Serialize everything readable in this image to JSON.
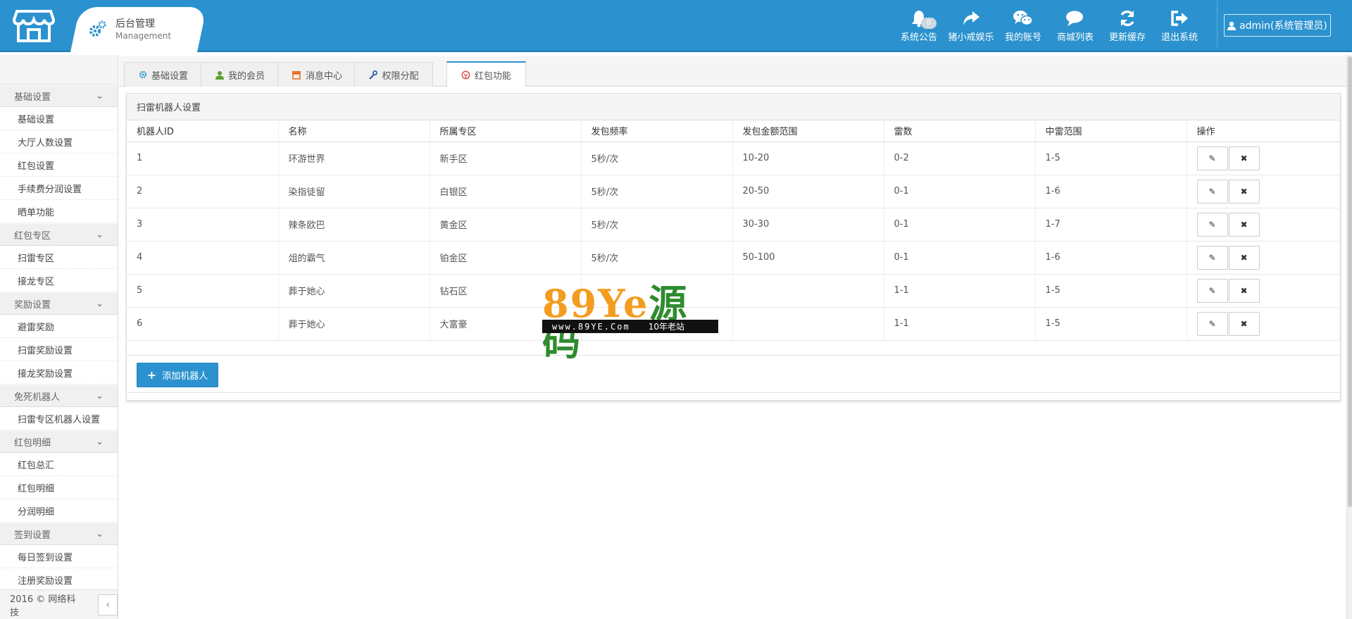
{
  "header": {
    "brand_title": "后台管理",
    "brand_sub": "Management",
    "notification_count": "0",
    "menu": [
      {
        "label": "系统公告",
        "icon": "bell-icon"
      },
      {
        "label": "猪小戒娱乐",
        "icon": "share-icon"
      },
      {
        "label": "我的账号",
        "icon": "wechat-icon"
      },
      {
        "label": "商城列表",
        "icon": "comments-icon"
      },
      {
        "label": "更新缓存",
        "icon": "refresh-icon"
      },
      {
        "label": "退出系统",
        "icon": "sign-out-icon"
      }
    ],
    "admin_label": "admin(系统管理员)"
  },
  "sidebar": {
    "groups": [
      {
        "label": "基础设置",
        "items": [
          "基础设置",
          "大厅人数设置",
          "红包设置",
          "手续费分润设置",
          "晒单功能"
        ]
      },
      {
        "label": "红包专区",
        "items": [
          "扫雷专区",
          "接龙专区"
        ]
      },
      {
        "label": "奖励设置",
        "items": [
          "避雷奖励",
          "扫雷奖励设置",
          "接龙奖励设置"
        ]
      },
      {
        "label": "免死机器人",
        "items": [
          "扫雷专区机器人设置"
        ]
      },
      {
        "label": "红包明细",
        "items": [
          "红包总汇",
          "红包明细",
          "分润明细"
        ]
      },
      {
        "label": "签到设置",
        "items": [
          "每日签到设置",
          "注册奖励设置"
        ]
      }
    ],
    "footer": "2016 © 网络科技",
    "collapse": "‹"
  },
  "tabs": [
    {
      "label": "基础设置",
      "icon": "gear-icon"
    },
    {
      "label": "我的会员",
      "icon": "user-icon"
    },
    {
      "label": "消息中心",
      "icon": "store-icon"
    },
    {
      "label": "权限分配",
      "icon": "wrench-icon"
    },
    {
      "label": "红包功能",
      "icon": "redpacket-icon"
    }
  ],
  "panel": {
    "title": "扫雷机器人设置",
    "columns": [
      "机器人ID",
      "名称",
      "所属专区",
      "发包频率",
      "发包金额范围",
      "雷数",
      "中雷范围",
      "操作"
    ],
    "rows": [
      [
        "1",
        "环游世界",
        "新手区",
        "5秒/次",
        "10-20",
        "0-2",
        "1-5"
      ],
      [
        "2",
        "染指徒留",
        "白银区",
        "5秒/次",
        "20-50",
        "0-1",
        "1-6"
      ],
      [
        "3",
        "辣条欧巴",
        "黄金区",
        "5秒/次",
        "30-30",
        "0-1",
        "1-7"
      ],
      [
        "4",
        "俎的霸气",
        "铂金区",
        "5秒/次",
        "50-100",
        "0-1",
        "1-6"
      ],
      [
        "5",
        "葬于她心",
        "钻石区",
        "",
        "",
        "1-1",
        "1-5"
      ],
      [
        "6",
        "葬于她心",
        "大富豪",
        "",
        "",
        "1-1",
        "1-5"
      ]
    ],
    "add_button": "添加机器人"
  },
  "watermark": {
    "big_a": "89Ye",
    "big_b": "源码",
    "url": "www.89YE.Com",
    "tag": "10年老站"
  },
  "colors": {
    "primary": "#2b92cf"
  }
}
